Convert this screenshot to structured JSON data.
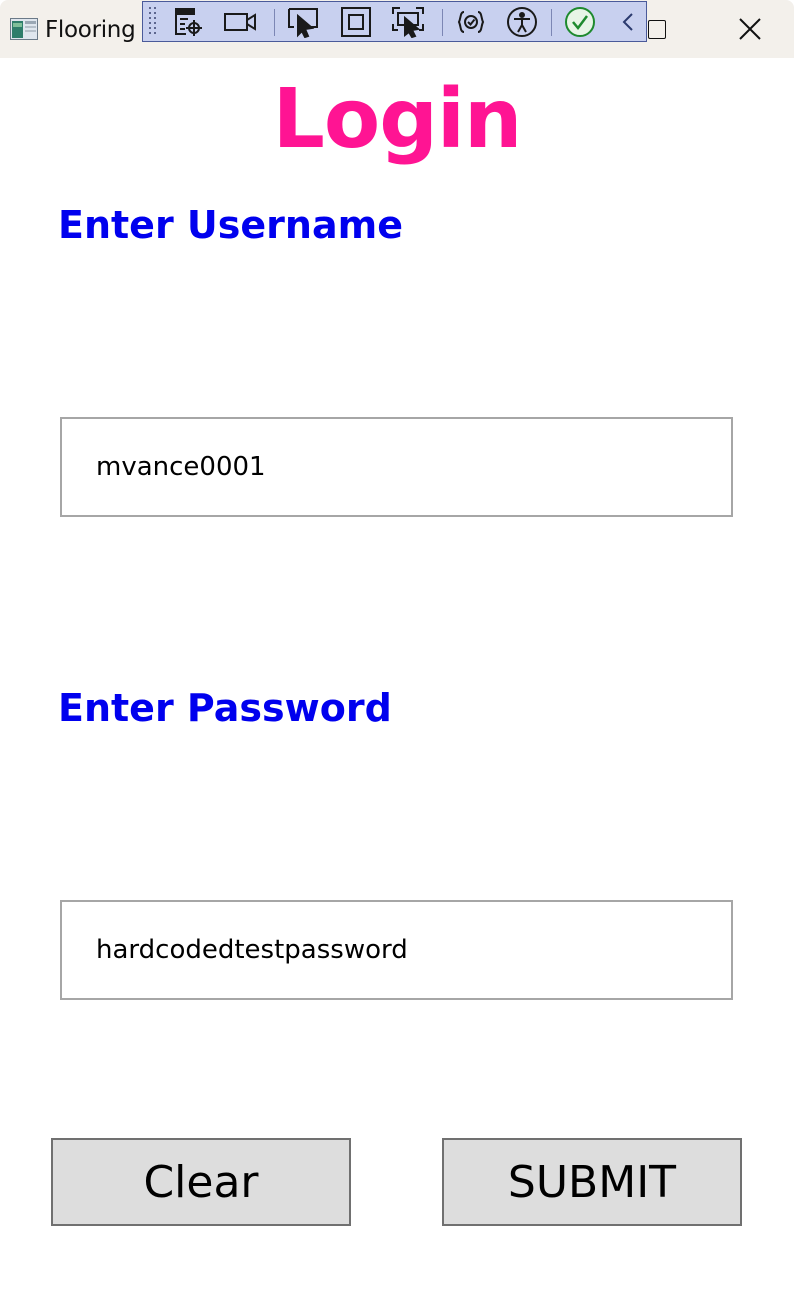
{
  "window": {
    "title": "Flooring C",
    "app_icon": "app-window-icon",
    "controls": [
      "maximize-icon",
      "close-icon"
    ]
  },
  "debug_toolbar": {
    "tools": [
      "drag-grip-icon",
      "select-element-icon",
      "video-record-icon",
      "pointer-select-icon",
      "display-layout-adorners-icon",
      "track-focus-icon",
      "binding-failures-icon",
      "accessibility-icon",
      "checkmark-icon",
      "collapse-chevron-icon"
    ]
  },
  "page": {
    "title": "Login",
    "username_label": "Enter Username",
    "username_value": "mvance0001",
    "password_label": "Enter Password",
    "password_value": "hardcodedtestpassword",
    "clear_label": "Clear",
    "submit_label": "SUBMIT"
  },
  "colors": {
    "title": "#ff1493",
    "labels": "#0000ee",
    "button_bg": "#dddddd",
    "toolbar_bg": "#c8d0ef"
  }
}
